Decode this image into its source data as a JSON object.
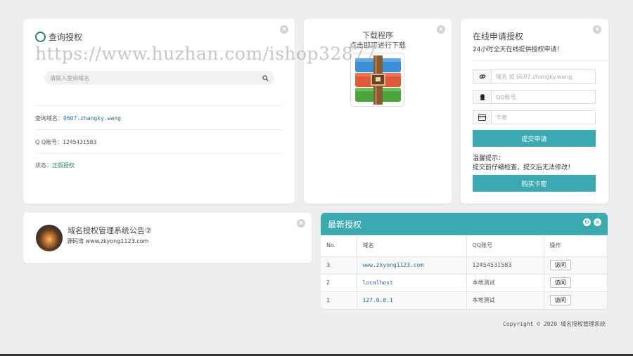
{
  "query_card": {
    "title": "查询授权",
    "search_placeholder": "请输入查询域名",
    "domain_label": "查询域名：",
    "domain_value": "0607.zhangky.wang",
    "qq_label": "Q Q账号：",
    "qq_value": "1245431583",
    "status_label": "状态：",
    "status_value": "正版授权"
  },
  "download_card": {
    "title": "下载程序",
    "subtitle": "点击即可进行下载",
    "icon": "winrar-package-icon"
  },
  "apply_card": {
    "title": "在线申请授权",
    "subtitle": "24小时全天在线提供授权申请！",
    "domain_placeholder": "域名 如 0607.zhangky.wang",
    "qq_placeholder": "QQ账号",
    "card_placeholder": "卡密",
    "submit_label": "提交申请",
    "tip_title": "温馨提示：",
    "tip_text": "提交前仔细检查，提交后无法修改！",
    "buy_label": "购买卡密"
  },
  "notice_card": {
    "title": "域名授权管理系统公告②",
    "subtitle": "源码湾 www.zkyong1123.com"
  },
  "latest_card": {
    "title": "最新授权",
    "columns": [
      "No.",
      "域名",
      "QQ账号",
      "操作"
    ],
    "rows": [
      {
        "no": "3",
        "domain": "www.zkyong1123.com",
        "qq": "12454531583",
        "action": "访问"
      },
      {
        "no": "2",
        "domain": "localhost",
        "qq": "本地测试",
        "action": "访问"
      },
      {
        "no": "1",
        "domain": "127.0.0.1",
        "qq": "本地测试",
        "action": "访问"
      }
    ]
  },
  "footer": {
    "copyright": "Copyright © 2020 域名授权管理系统"
  },
  "watermark": "https://www.huzhan.com/ishop32877",
  "colors": {
    "accent": "#3aaab0",
    "ring": "#1d8a6a",
    "link": "#2b6ca3"
  }
}
